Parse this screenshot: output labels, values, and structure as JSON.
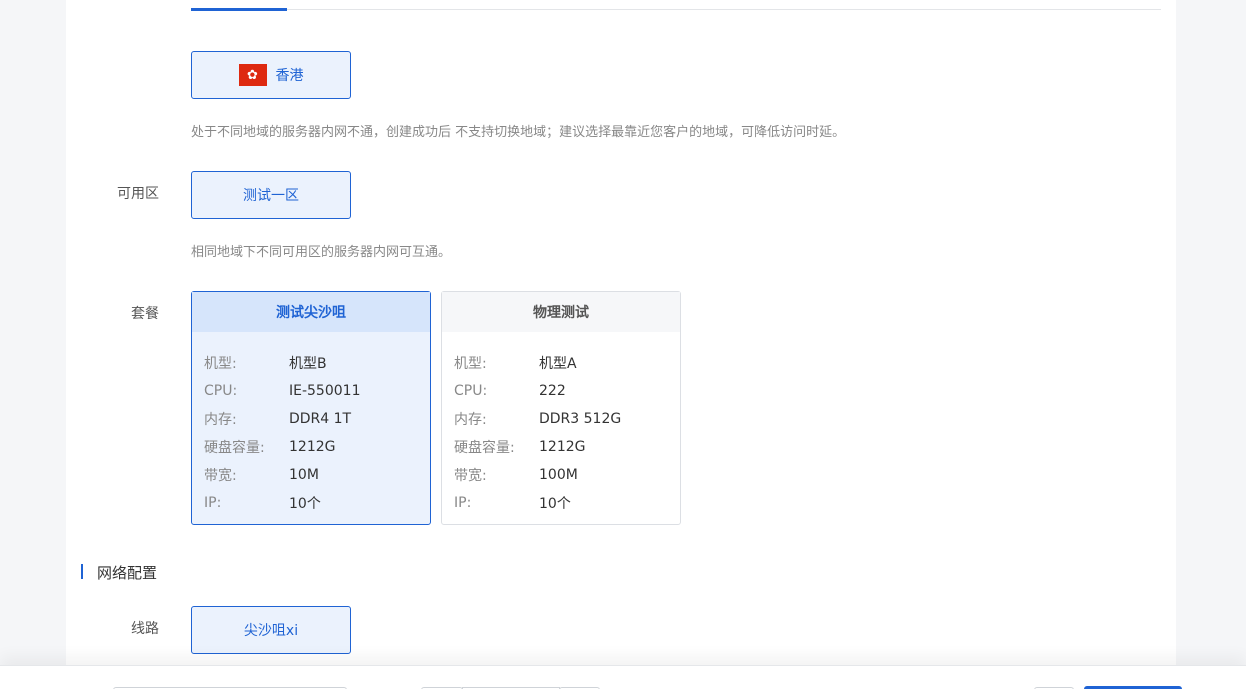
{
  "region": {
    "option_label": "香港",
    "flag_symbol": "✿",
    "hint": "处于不同地域的服务器内网不通，创建成功后 不支持切换地域；建议选择最靠近您客户的地域，可降低访问时延。"
  },
  "zone": {
    "label": "可用区",
    "option_label": "测试一区",
    "hint": "相同地域下不同可用区的服务器内网可互通。"
  },
  "package": {
    "label": "套餐",
    "options": [
      {
        "title": "测试尖沙咀",
        "selected": true,
        "specs": [
          {
            "key": "机型:",
            "value": "机型B"
          },
          {
            "key": "CPU:",
            "value": "IE-550011"
          },
          {
            "key": "内存:",
            "value": "DDR4 1T"
          },
          {
            "key": "硬盘容量:",
            "value": "1212G"
          },
          {
            "key": "带宽:",
            "value": "10M"
          },
          {
            "key": "IP:",
            "value": "10个"
          }
        ]
      },
      {
        "title": "物理测试",
        "selected": false,
        "specs": [
          {
            "key": "机型:",
            "value": "机型A"
          },
          {
            "key": "CPU:",
            "value": "222"
          },
          {
            "key": "内存:",
            "value": "DDR3 512G"
          },
          {
            "key": "硬盘容量:",
            "value": "1212G"
          },
          {
            "key": "带宽:",
            "value": "100M"
          },
          {
            "key": "IP:",
            "value": "10个"
          }
        ]
      }
    ]
  },
  "network": {
    "section_title": "网络配置",
    "line_label": "线路",
    "line_option": "尖沙咀xi"
  },
  "colors": {
    "accent": "#1f63d4",
    "selected_bg": "#ebf2fd",
    "flag_red": "#de2910"
  }
}
